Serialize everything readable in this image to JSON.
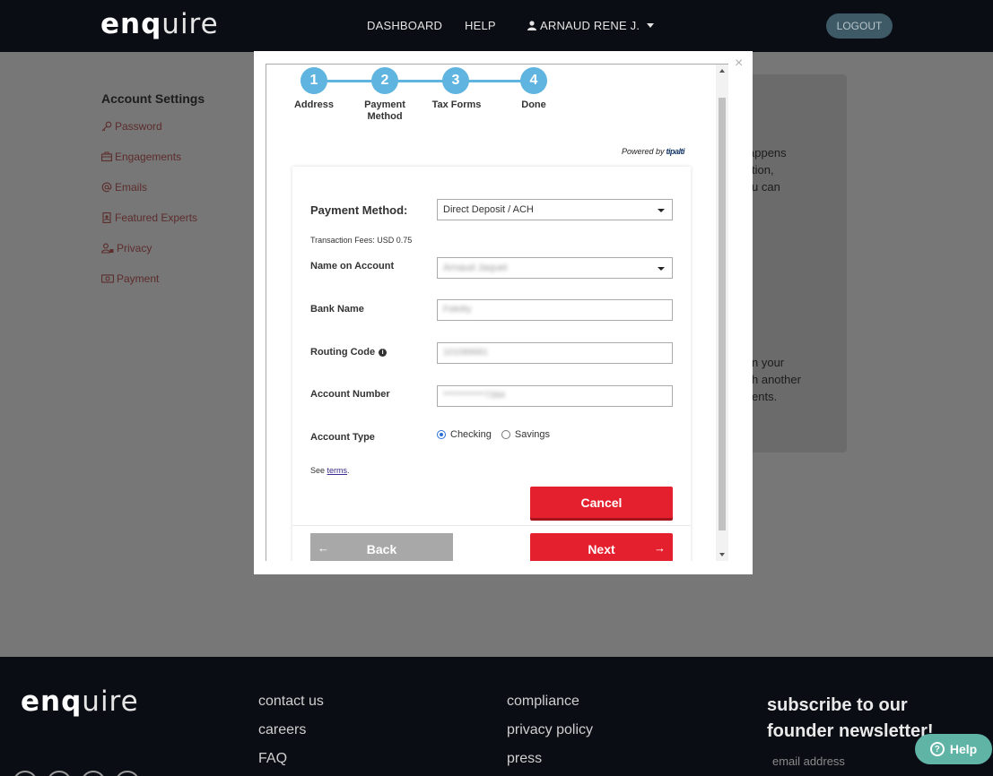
{
  "nav": {
    "logo_bold": "enq",
    "logo_thin": "uire",
    "dashboard": "DASHBOARD",
    "help": "HELP",
    "user": "ARNAUD RENE J.",
    "logout": "LOGOUT"
  },
  "sidebar": {
    "title": "Account Settings",
    "items": [
      {
        "label": "Password",
        "icon": "key-icon"
      },
      {
        "label": "Engagements",
        "icon": "briefcase-icon"
      },
      {
        "label": "Emails",
        "icon": "at-icon"
      },
      {
        "label": "Featured Experts",
        "icon": "badge-icon"
      },
      {
        "label": "Privacy",
        "icon": "user-lock-icon"
      },
      {
        "label": "Payment",
        "icon": "money-icon"
      }
    ]
  },
  "side_card_text": {
    "line1": "appens",
    "line2": "tion,",
    "line3": "u can",
    "line4": "n your",
    "line5": "h another",
    "line6": "ents."
  },
  "modal": {
    "close": "×",
    "steps": [
      {
        "num": "1",
        "label": "Address"
      },
      {
        "num": "2",
        "label": "Payment Method"
      },
      {
        "num": "3",
        "label": "Tax Forms"
      },
      {
        "num": "4",
        "label": "Done"
      }
    ],
    "powered_by": "Powered by",
    "powered_brand": "tipalti",
    "form": {
      "payment_method_label": "Payment Method:",
      "payment_method_value": "Direct Deposit / ACH",
      "fees": "Transaction Fees: USD 0.75",
      "name_label": "Name on Account",
      "name_value": "Arnaud Jaquet",
      "bank_label": "Bank Name",
      "bank_value": "Fidelity",
      "routing_label": "Routing Code",
      "routing_value": "101089681",
      "account_label": "Account Number",
      "account_value": "************7394",
      "type_label": "Account Type",
      "type_options": [
        "Checking",
        "Savings"
      ],
      "type_selected": "Checking",
      "see": "See",
      "terms": "terms",
      "period": ".",
      "cancel": "Cancel",
      "back": "Back",
      "next": "Next"
    }
  },
  "footer": {
    "col1": [
      "contact us",
      "careers",
      "FAQ"
    ],
    "col2": [
      "compliance",
      "privacy policy",
      "press"
    ],
    "subscribe": "subscribe to our founder newsletter!",
    "email_placeholder": "email address",
    "help": "Help"
  },
  "colors": {
    "accent_red": "#e4202e",
    "step_blue": "#5fb4e0",
    "navbar": "#0b0d14",
    "help_teal": "#5fb4a6"
  }
}
